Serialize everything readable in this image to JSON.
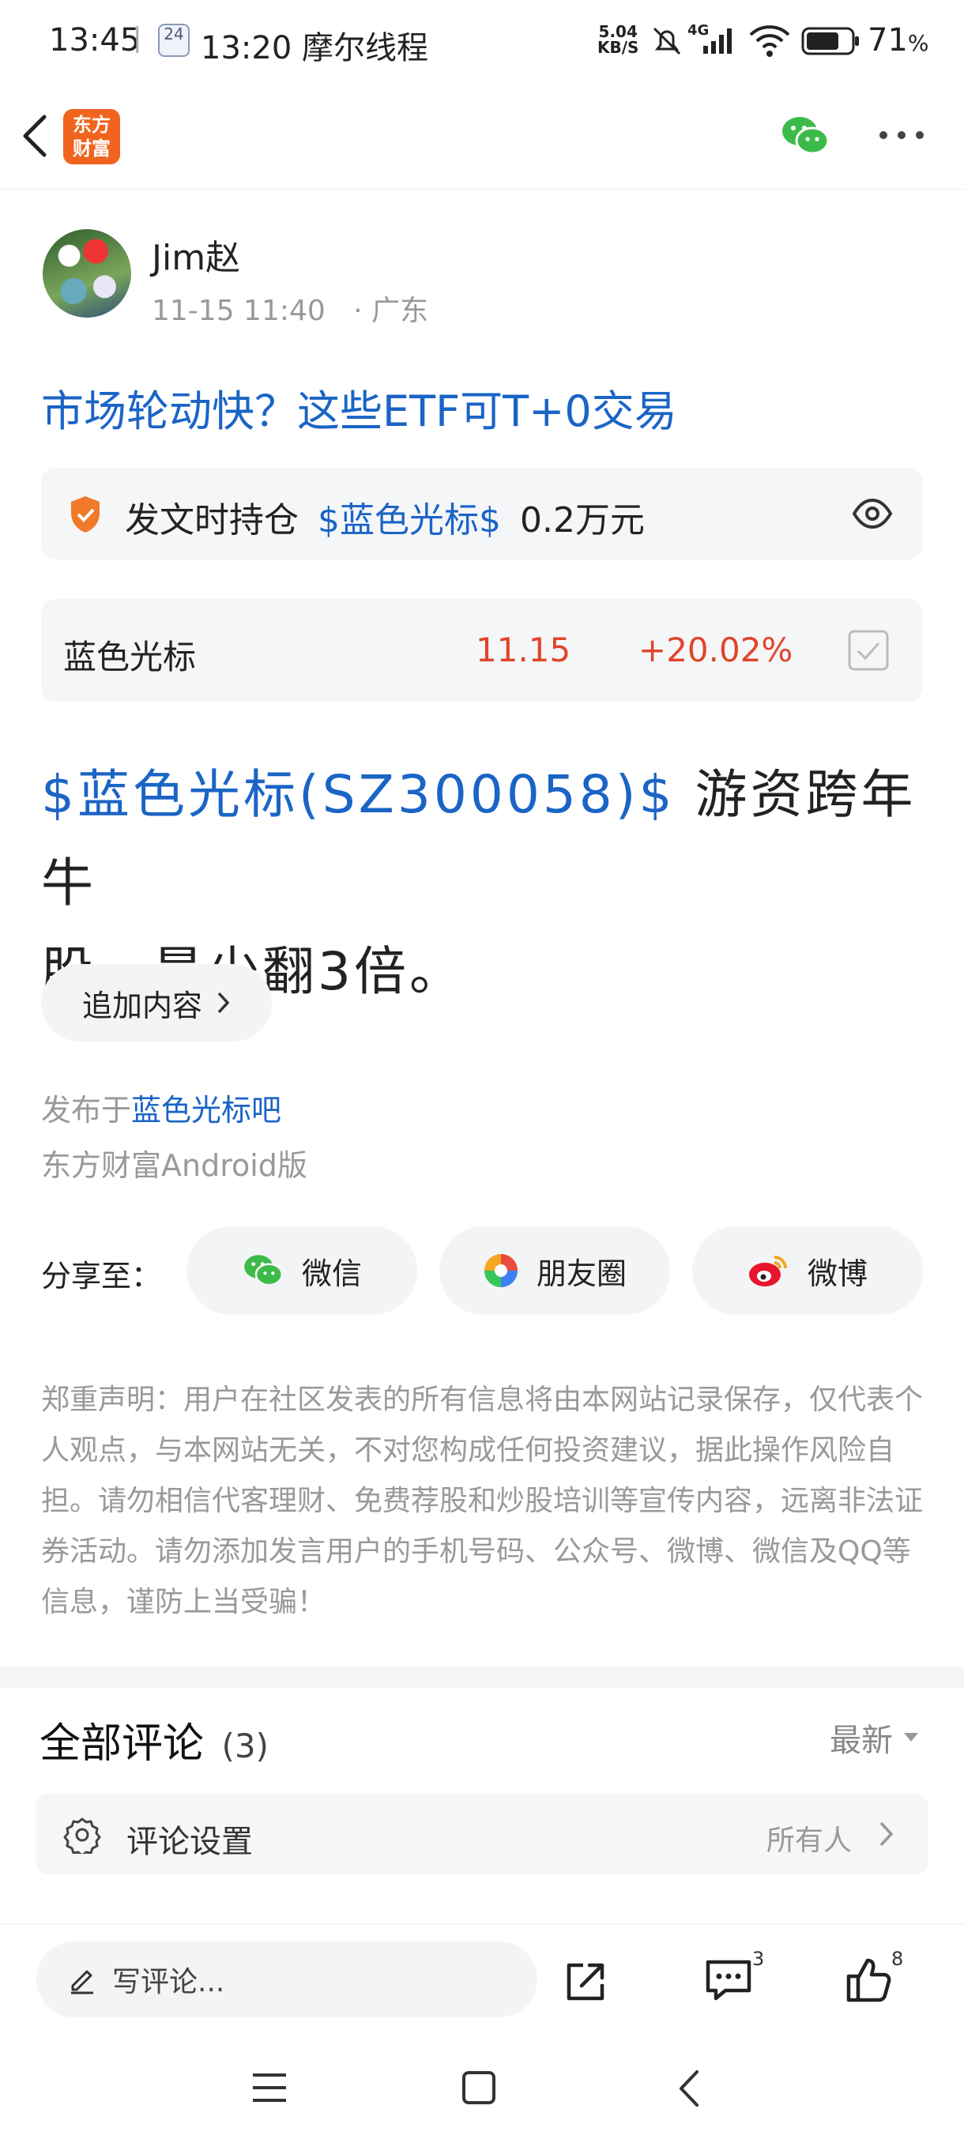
{
  "status_bar": {
    "time": "13:45",
    "calendar_day": "24",
    "app_note": "13:20 摩尔线程",
    "net_speed_value": "5.04",
    "net_speed_unit": "KB/S",
    "network": "4G",
    "battery": "71",
    "battery_unit": "%"
  },
  "post": {
    "author": "Jim赵",
    "time": "11-15 11:40",
    "location": "· 广东",
    "title": "市场轮动快？这些ETF可T+0交易",
    "holding": {
      "prefix": "发文时持仓",
      "stock": "$蓝色光标$",
      "amount": "0.2万元"
    },
    "quote": {
      "name": "蓝色光标",
      "price": "11.15",
      "change": "+20.02%"
    },
    "body_link": "$蓝色光标(SZ300058)$",
    "body_line1": " 游资跨年牛",
    "body_line2": "股，最少翻3倍。",
    "append_label": "追加内容",
    "published_prefix": "发布于",
    "published_bar": "蓝色光标吧",
    "client": "东方财富Android版"
  },
  "share": {
    "label": "分享至：",
    "wechat": "微信",
    "moments": "朋友圈",
    "weibo": "微博"
  },
  "disclaimer": "郑重声明：用户在社区发表的所有信息将由本网站记录保存，仅代表个人观点，与本网站无关，不对您构成任何投资建议，据此操作风险自担。请勿相信代客理财、免费荐股和炒股培训等宣传内容，远离非法证券活动。请勿添加发言用户的手机号码、公众号、微博、微信及QQ等信息，谨防上当受骗！",
  "comments": {
    "title": "全部评论",
    "count": "(3)",
    "sort": "最新",
    "settings_label": "评论设置",
    "settings_value": "所有人"
  },
  "bottom": {
    "placeholder": "写评论...",
    "comment_count": "3",
    "like_count": "8"
  },
  "colors": {
    "accent": "#1a64c6",
    "up": "#e0452a",
    "brand": "#f0641e"
  }
}
